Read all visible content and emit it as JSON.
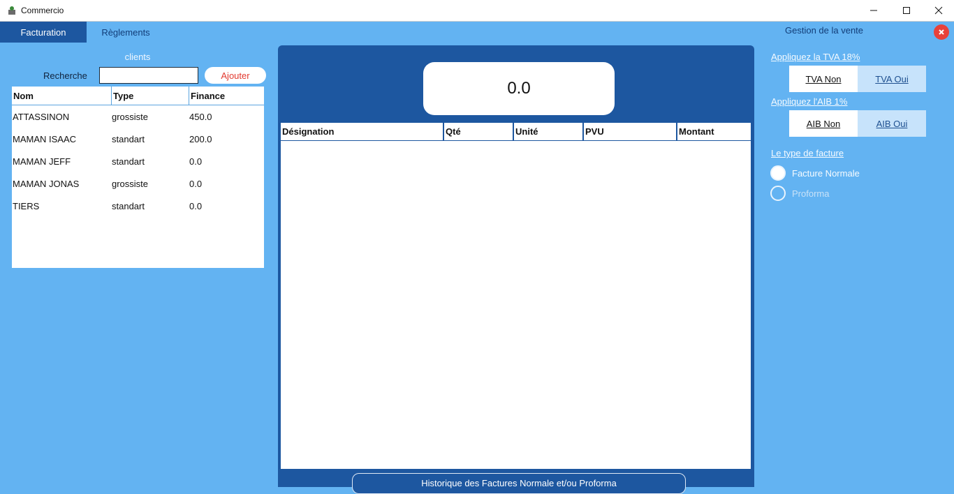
{
  "window": {
    "title": "Commercio",
    "app_icon": "commercio-app-icon"
  },
  "tabs": [
    {
      "label": "Facturation",
      "active": true
    },
    {
      "label": "Règlements",
      "active": false
    }
  ],
  "header": {
    "section_title": "Gestion de la vente"
  },
  "clients": {
    "title": "clients",
    "search_label": "Recherche",
    "search_value": "",
    "add_button": "Ajouter",
    "columns": [
      "Nom",
      "Type",
      "Finance"
    ],
    "rows": [
      [
        "ATTASSINON",
        "grossiste",
        "450.0"
      ],
      [
        "MAMAN ISAAC",
        "standart",
        "200.0"
      ],
      [
        "MAMAN JEFF",
        "standart",
        "0.0"
      ],
      [
        "MAMAN JONAS",
        "grossiste",
        "0.0"
      ],
      [
        "TIERS",
        "standart",
        "0.0"
      ]
    ]
  },
  "invoice": {
    "total": "0.0",
    "columns": [
      "Désignation",
      "Qté",
      "Unité",
      "PVU",
      "Montant"
    ],
    "history_button": "Historique des Factures Normale et/ou Proforma"
  },
  "options": {
    "tva": {
      "label": "Appliquez la TVA 18%",
      "no": "TVA Non",
      "yes": "TVA Oui",
      "selected": "no"
    },
    "aib": {
      "label": "Appliquez l'AIB 1%",
      "no": "AIB Non",
      "yes": "AIB Oui",
      "selected": "no"
    },
    "invoice_type": {
      "label": "Le type de facture",
      "normal": "Facture Normale",
      "proforma": "Proforma",
      "selected": "normal"
    }
  },
  "colors": {
    "background": "#63b3f2",
    "primary": "#1d57a0",
    "danger": "#e8413a"
  }
}
